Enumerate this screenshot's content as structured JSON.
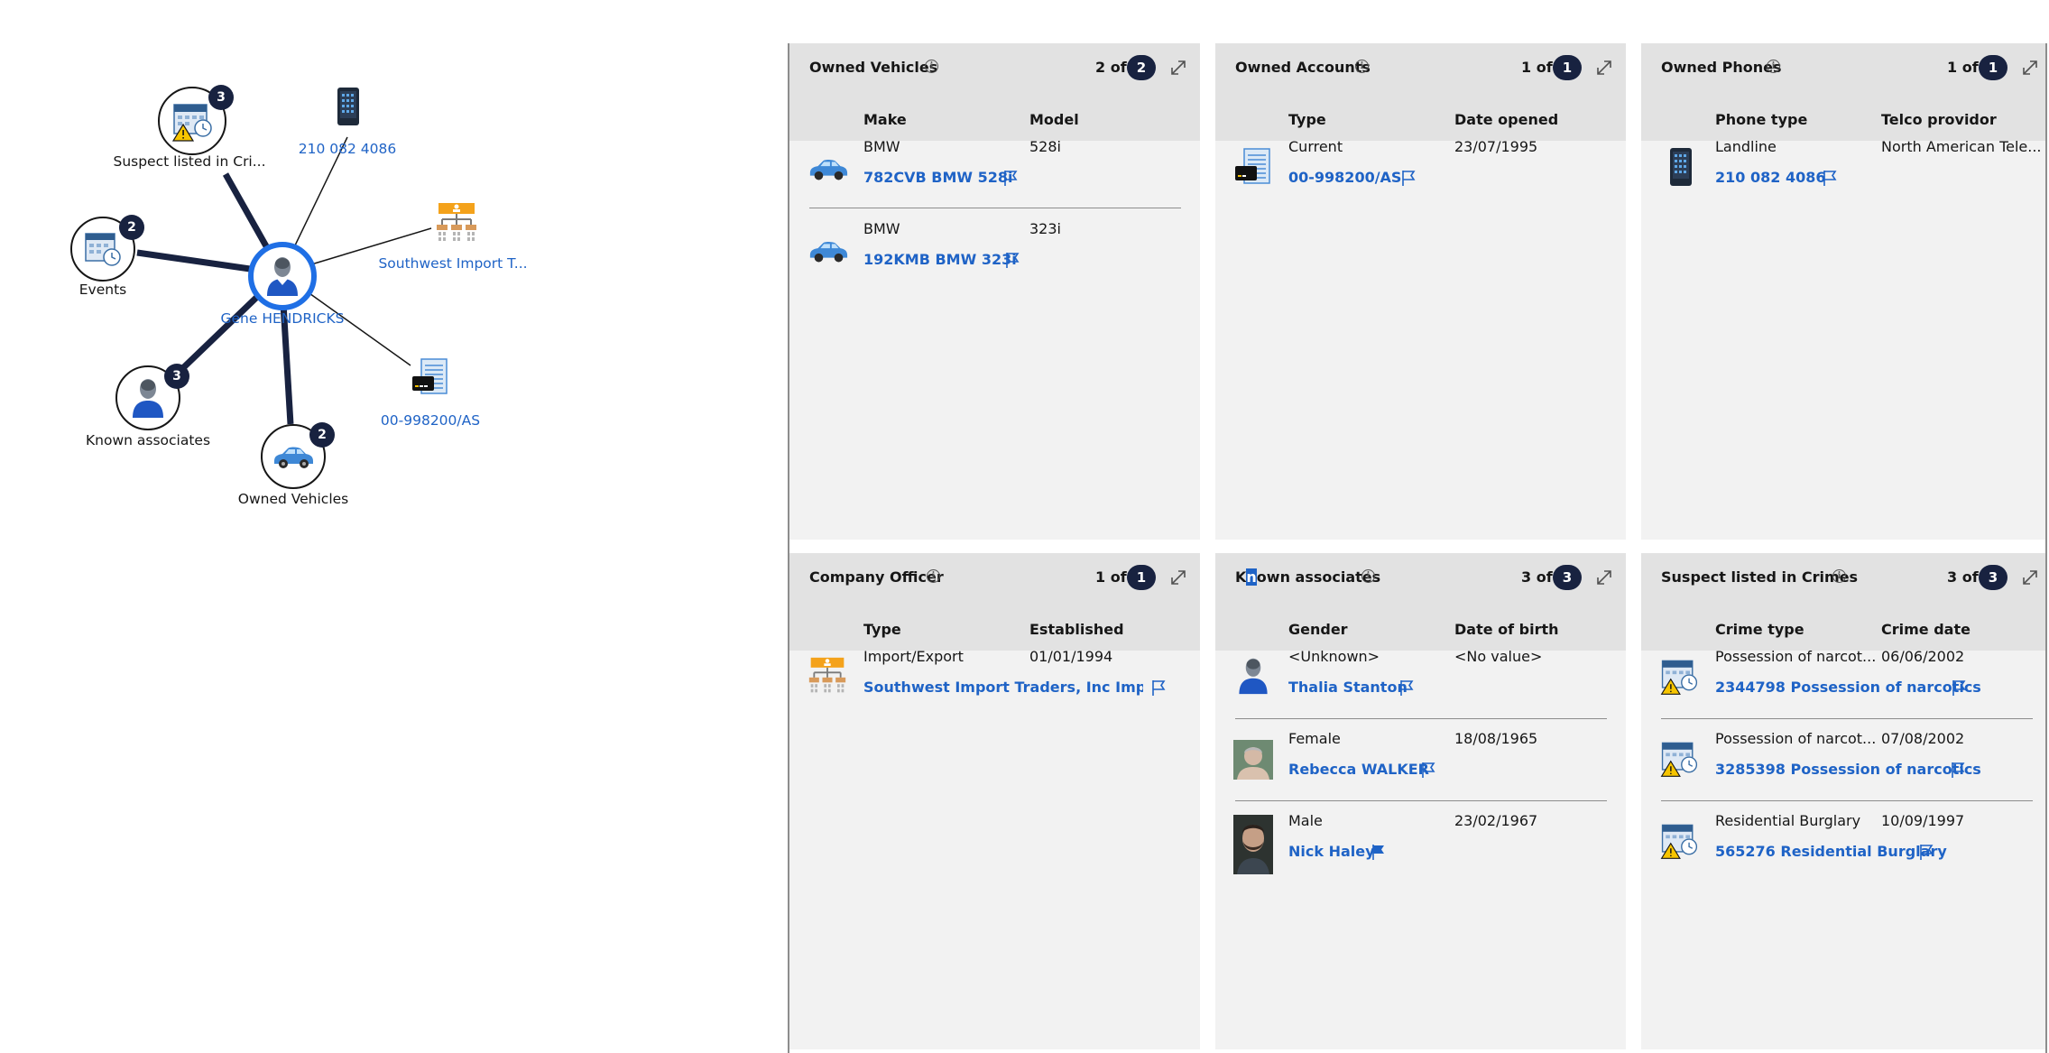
{
  "graph": {
    "center": {
      "label": "Gene HENDRICKS"
    },
    "nodes": {
      "suspect": {
        "label": "Suspect listed in Cri...",
        "count": "3"
      },
      "phone": {
        "label": "210 082 4086"
      },
      "events": {
        "label": "Events",
        "count": "2"
      },
      "company": {
        "label": "Southwest Import T..."
      },
      "associates": {
        "label": "Known associates",
        "count": "3"
      },
      "account": {
        "label": "00-998200/AS"
      },
      "vehicles": {
        "label": "Owned Vehicles",
        "count": "2"
      }
    }
  },
  "cards": {
    "vehicles": {
      "title": "Owned Vehicles",
      "count_text": "2 of",
      "total": "2",
      "columns": [
        "Make",
        "Model"
      ],
      "rows": [
        {
          "c1": "BMW",
          "c2": "528i",
          "link": "782CVB BMW 528i"
        },
        {
          "c1": "BMW",
          "c2": "323i",
          "link": "192KMB BMW 323i"
        }
      ]
    },
    "accounts": {
      "title": "Owned Accounts",
      "count_text": "1 of",
      "total": "1",
      "columns": [
        "Type",
        "Date opened"
      ],
      "rows": [
        {
          "c1": "Current",
          "c2": "23/07/1995",
          "link": "00-998200/AS"
        }
      ]
    },
    "phones": {
      "title": "Owned Phones",
      "count_text": "1 of",
      "total": "1",
      "columns": [
        "Phone type",
        "Telco providor"
      ],
      "rows": [
        {
          "c1": "Landline",
          "c2": "North American Tele...",
          "link": "210 082 4086"
        }
      ]
    },
    "company": {
      "title": "Company Officer",
      "count_text": "1 of",
      "total": "1",
      "columns": [
        "Type",
        "Established"
      ],
      "rows": [
        {
          "c1": "Import/Export",
          "c2": "01/01/1994",
          "link": "Southwest Import Traders, Inc Import..."
        }
      ]
    },
    "associates": {
      "title_pre": "K",
      "title_sel": "n",
      "title_post": "own associates",
      "count_text": "3 of",
      "total": "3",
      "columns": [
        "Gender",
        "Date of birth"
      ],
      "rows": [
        {
          "c1": "<Unknown>",
          "c2": "<No value>",
          "link": "Thalia Stanton"
        },
        {
          "c1": "Female",
          "c2": "18/08/1965",
          "link": "Rebecca WALKER"
        },
        {
          "c1": "Male",
          "c2": "23/02/1967",
          "link": "Nick Haley"
        }
      ]
    },
    "crimes": {
      "title": "Suspect listed in Crimes",
      "count_text": "3 of",
      "total": "3",
      "columns": [
        "Crime type",
        "Crime date"
      ],
      "rows": [
        {
          "c1": "Possession of narcot...",
          "c2": "06/06/2002",
          "link": "2344798 Possession of narcotics"
        },
        {
          "c1": "Possession of narcot...",
          "c2": "07/08/2002",
          "link": "3285398 Possession of narcotics"
        },
        {
          "c1": "Residential Burglary",
          "c2": "10/09/1997",
          "link": "565276 Residential Burglary"
        }
      ]
    }
  },
  "colors": {
    "link": "#1f63c6",
    "badge": "#182240",
    "card_bg": "#f2f2f2",
    "header_bg": "#e2e2e2",
    "center_ring": "#1f6fe5"
  }
}
